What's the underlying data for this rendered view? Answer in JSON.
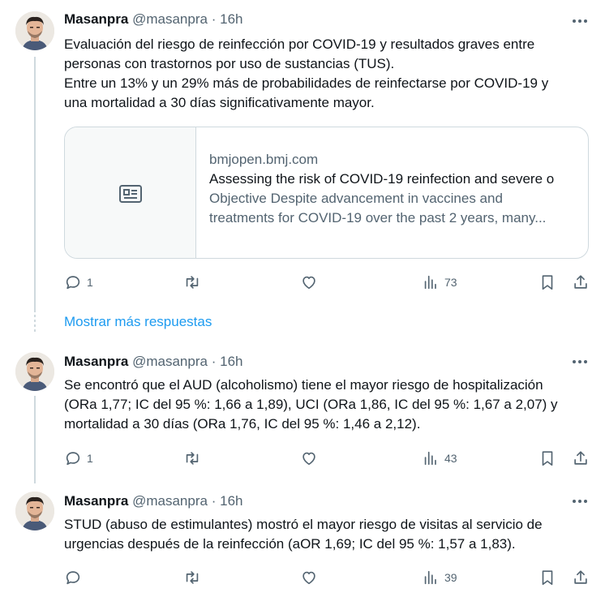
{
  "tweets": [
    {
      "name": "Masanpra",
      "handle": "@masanpra",
      "separator": "·",
      "time": "16h",
      "lines": [
        "Evaluación del riesgo de reinfección por COVID-19 y resultados graves entre",
        "personas con trastornos por uso de sustancias (TUS).",
        "Entre un 13% y un 29% más de probabilidades de reinfectarse por COVID-19 y",
        "una mortalidad a 30 días significativamente mayor."
      ],
      "card": {
        "domain": "bmjopen.bmj.com",
        "title": "Assessing the risk of COVID-19 reinfection and severe o",
        "description_lines": [
          "Objective Despite advancement in vaccines and",
          "treatments for COVID-19 over the past 2 years, many..."
        ],
        "thumb_icon": "article-icon"
      },
      "replies": "1",
      "retweets": "",
      "likes": "",
      "views": "73"
    },
    {
      "name": "Masanpra",
      "handle": "@masanpra",
      "separator": "·",
      "time": "16h",
      "lines": [
        "Se encontró que el AUD (alcoholismo) tiene el mayor riesgo de hospitalización",
        "(ORa 1,77; IC del 95 %: 1,66 a 1,89), UCI (ORa 1,86, IC del 95 %: 1,67 a 2,07) y",
        "mortalidad a 30 días (ORa 1,76, IC del 95 %: 1,46 a 2,12)."
      ],
      "replies": "1",
      "retweets": "",
      "likes": "",
      "views": "43"
    },
    {
      "name": "Masanpra",
      "handle": "@masanpra",
      "separator": "·",
      "time": "16h",
      "lines": [
        "STUD (abuso de estimulantes) mostró el mayor riesgo de visitas al servicio de",
        "urgencias después de la reinfección (aOR 1,69; IC del 95 %: 1,57 a 1,83)."
      ],
      "replies": "",
      "retweets": "",
      "likes": "",
      "views": "39"
    }
  ],
  "show_more_replies": "Mostrar más respuestas",
  "icons": {
    "reply": "reply-icon",
    "retweet": "retweet-icon",
    "like": "heart-icon",
    "views": "views-chart-icon",
    "bookmark": "bookmark-icon",
    "share": "share-icon",
    "more": "more-dots-icon"
  },
  "colors": {
    "text": "#0f1419",
    "secondary": "#536471",
    "link": "#1d9bf0",
    "border": "#cfd9de",
    "card_thumb_bg": "#f7f9f9"
  }
}
